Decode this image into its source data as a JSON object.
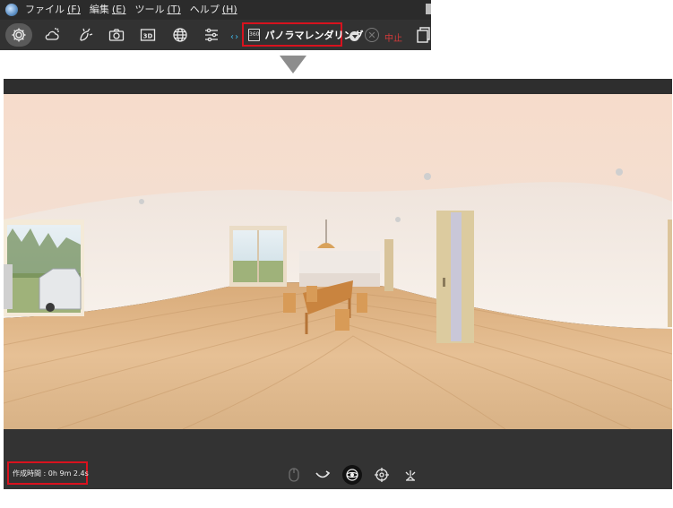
{
  "menu": {
    "items": [
      {
        "label": "ファイル",
        "key": "(F)"
      },
      {
        "label": "編集",
        "key": "(E)"
      },
      {
        "label": "ツール",
        "key": "(T)"
      },
      {
        "label": "ヘルプ",
        "key": "(H)"
      }
    ]
  },
  "toolbar": {
    "tools": [
      "settings-icon",
      "weather-icon",
      "light-icon",
      "camera-icon",
      "3d-view-icon",
      "globe-icon",
      "adjust-sliders-icon"
    ],
    "active_tool": "settings-icon",
    "pano_icon_text": "360",
    "pano_label": "パノラマレンダリング",
    "stop_label": "中止",
    "highlight_color": "#d8121e"
  },
  "render": {
    "time_label": "作成時間 : 0h 9m 2.4s",
    "controls": [
      "mouse-icon",
      "rotate-icon",
      "pano-view-icon",
      "target-icon",
      "light-burst-icon"
    ],
    "active_control": "pano-view-icon"
  }
}
